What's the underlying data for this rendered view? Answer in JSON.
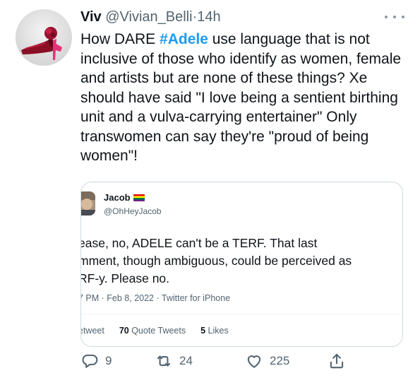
{
  "tweet": {
    "display_name": "Viv",
    "handle": "@Vivian_Belli",
    "separator": "·",
    "time": "14h",
    "text_before": "How DARE ",
    "hashtag": "#Adele",
    "text_after": " use language that is not inclusive of those who identify as women, female and artists but are none of these things? Xe should have said \"I love being a sentient birthing unit and a vulva-carrying entertainer\" Only transwomen can say they're \"proud of being women\"!"
  },
  "quote": {
    "display_name": "Jacob",
    "handle": "@OhHeyJacob",
    "line1": "ease, no, ADELE can't be a TERF. That last",
    "line2": "mment, though ambiguous, could be perceived as",
    "line3": "RF-y. Please no.",
    "meta": "7 PM · Feb 8, 2022 · Twitter for iPhone",
    "retweet_label_partial": "etweet",
    "quote_count": "70",
    "quote_label": "Quote Tweets",
    "like_count": "5",
    "like_label": "Likes",
    "flag_colors": [
      "#e40303",
      "#ff8c00",
      "#ffed00",
      "#008026",
      "#24408e",
      "#732982"
    ]
  },
  "actions": {
    "reply_count": "9",
    "retweet_count": "24",
    "like_count": "225"
  },
  "icons": {
    "more": "more-horizontal-icon",
    "reply": "reply-icon",
    "retweet": "retweet-icon",
    "like": "heart-icon",
    "share": "share-icon"
  },
  "colors": {
    "hashtag": "#1d9bf0",
    "muted": "#536471",
    "text": "#0f1419",
    "border": "#cfd9de"
  }
}
